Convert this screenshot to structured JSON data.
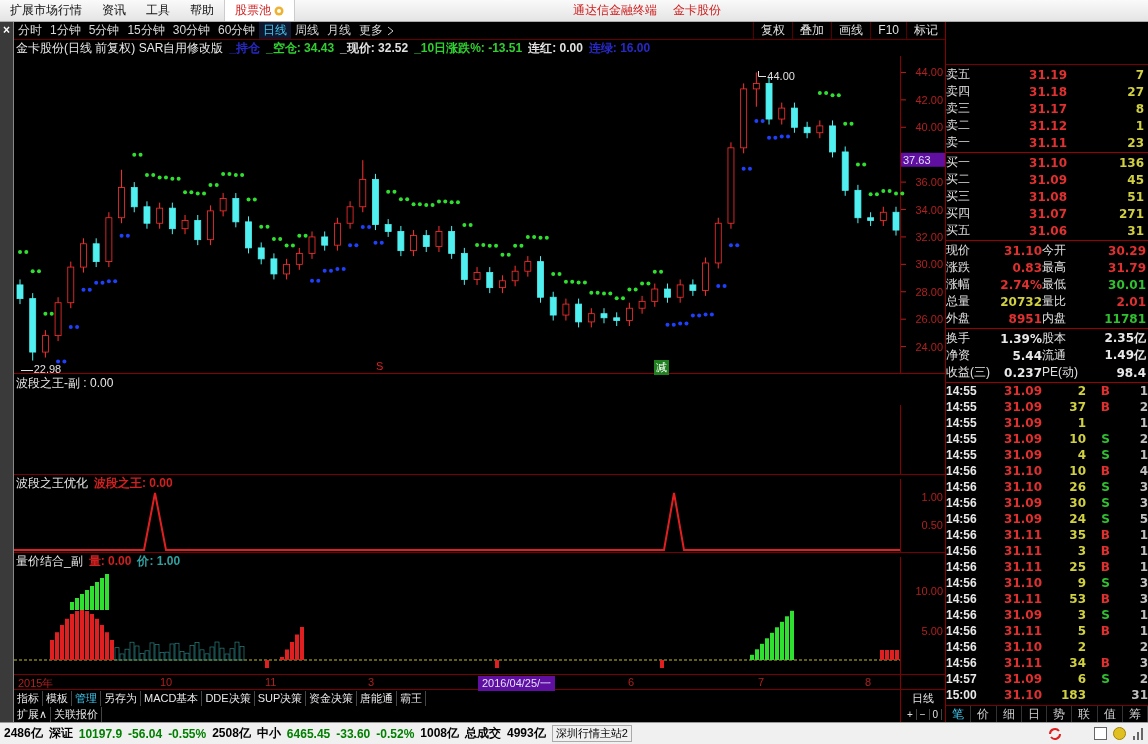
{
  "menu_bar": {
    "items": [
      "扩展市场行情",
      "资讯",
      "工具",
      "帮助"
    ],
    "pool": "股票池",
    "app_title": "通达信金融终端",
    "stock_title": "金卡股份"
  },
  "close_button": "×",
  "period_tabs": [
    {
      "label": "分时",
      "selected": false
    },
    {
      "label": "1分钟",
      "selected": false
    },
    {
      "label": "5分钟",
      "selected": false
    },
    {
      "label": "15分钟",
      "selected": false
    },
    {
      "label": "30分钟",
      "selected": false
    },
    {
      "label": "60分钟",
      "selected": false
    },
    {
      "label": "日线",
      "selected": true
    },
    {
      "label": "周线",
      "selected": false
    },
    {
      "label": "月线",
      "selected": false
    },
    {
      "label": "更多",
      "selected": false
    }
  ],
  "toolbar_buttons": [
    "复权",
    "叠加",
    "画线",
    "F10",
    "标记"
  ],
  "main_chart": {
    "title": "金卡股份(日线 前复权) SAR自用修改版",
    "indicators": [
      {
        "text": "_持仓",
        "color": "#2828c8"
      },
      {
        "text": "_空仓: 34.43",
        "color": "#30d030"
      },
      {
        "text": "_现价: 32.52",
        "color": "#e0e0e0"
      },
      {
        "text": "_10日涨跌%: -13.51",
        "color": "#30d030"
      },
      {
        "text": "连红: 0.00",
        "color": "#e0e0e0"
      },
      {
        "text": "连绿: 16.00",
        "color": "#2828c8"
      }
    ],
    "chart_data": {
      "type": "candlestick",
      "ylim": [
        22,
        45.2
      ],
      "yticks": [
        {
          "value": 44,
          "label": "44.00"
        },
        {
          "value": 42,
          "label": "42.00"
        },
        {
          "value": 40,
          "label": "40.00"
        },
        {
          "value": 36,
          "label": "36.00"
        },
        {
          "value": 34,
          "label": "34.00"
        },
        {
          "value": 32,
          "label": "32.00"
        },
        {
          "value": 30,
          "label": "30.00"
        },
        {
          "value": 28,
          "label": "28.00"
        },
        {
          "value": 26,
          "label": "26.00"
        },
        {
          "value": 24,
          "label": "24.00"
        }
      ],
      "ohlc": [
        [
          28.5,
          28.9,
          27.1,
          27.5
        ],
        [
          27.5,
          27.9,
          22.98,
          23.6
        ],
        [
          23.6,
          25.2,
          23.2,
          24.8
        ],
        [
          24.8,
          27.6,
          24.4,
          27.2
        ],
        [
          27.2,
          30.2,
          26.8,
          29.8
        ],
        [
          29.8,
          31.9,
          29.4,
          31.5
        ],
        [
          31.5,
          31.9,
          29.8,
          30.2
        ],
        [
          30.2,
          33.8,
          29.8,
          33.4
        ],
        [
          33.4,
          36.9,
          33.0,
          35.6
        ],
        [
          35.6,
          36.0,
          33.8,
          34.2
        ],
        [
          34.2,
          34.6,
          32.6,
          33.0
        ],
        [
          33.0,
          34.5,
          32.6,
          34.1
        ],
        [
          34.1,
          34.5,
          32.2,
          32.6
        ],
        [
          32.6,
          33.6,
          32.2,
          33.2
        ],
        [
          33.2,
          33.6,
          31.4,
          31.8
        ],
        [
          31.8,
          34.3,
          31.4,
          33.9
        ],
        [
          33.9,
          35.2,
          33.5,
          34.8
        ],
        [
          34.8,
          35.2,
          32.7,
          33.1
        ],
        [
          33.1,
          33.5,
          30.8,
          31.2
        ],
        [
          31.2,
          31.6,
          30.0,
          30.4
        ],
        [
          30.4,
          30.8,
          28.9,
          29.3
        ],
        [
          29.3,
          30.4,
          28.9,
          30.0
        ],
        [
          30.0,
          31.2,
          29.6,
          30.8
        ],
        [
          30.8,
          32.4,
          30.4,
          32.0
        ],
        [
          32.0,
          32.4,
          31.0,
          31.4
        ],
        [
          31.4,
          33.4,
          31.0,
          33.0
        ],
        [
          33.0,
          34.6,
          32.6,
          34.2
        ],
        [
          34.2,
          37.6,
          33.8,
          36.2
        ],
        [
          36.2,
          36.6,
          32.5,
          32.9
        ],
        [
          32.9,
          33.3,
          32.0,
          32.4
        ],
        [
          32.4,
          32.8,
          30.6,
          31.0
        ],
        [
          31.0,
          32.5,
          30.6,
          32.1
        ],
        [
          32.1,
          32.5,
          30.9,
          31.3
        ],
        [
          31.3,
          32.8,
          30.9,
          32.4
        ],
        [
          32.4,
          32.8,
          30.4,
          30.8
        ],
        [
          30.8,
          31.2,
          28.5,
          28.9
        ],
        [
          28.9,
          29.8,
          28.5,
          29.4
        ],
        [
          29.4,
          29.8,
          27.9,
          28.3
        ],
        [
          28.3,
          29.2,
          27.9,
          28.8
        ],
        [
          28.8,
          29.9,
          28.4,
          29.5
        ],
        [
          29.5,
          30.6,
          29.1,
          30.2
        ],
        [
          30.2,
          30.6,
          27.2,
          27.6
        ],
        [
          27.6,
          28.0,
          25.9,
          26.3
        ],
        [
          26.3,
          27.5,
          25.9,
          27.1
        ],
        [
          27.1,
          27.5,
          25.4,
          25.8
        ],
        [
          25.8,
          26.8,
          25.4,
          26.4
        ],
        [
          26.4,
          26.8,
          25.7,
          26.1
        ],
        [
          26.1,
          26.5,
          25.5,
          25.9
        ],
        [
          25.9,
          27.2,
          25.5,
          26.8
        ],
        [
          26.8,
          27.7,
          26.4,
          27.3
        ],
        [
          27.3,
          28.6,
          26.9,
          28.2
        ],
        [
          28.2,
          28.6,
          27.2,
          27.6
        ],
        [
          27.6,
          28.9,
          27.2,
          28.5
        ],
        [
          28.5,
          28.9,
          27.7,
          28.1
        ],
        [
          28.1,
          30.5,
          27.7,
          30.1
        ],
        [
          30.1,
          33.4,
          29.7,
          33.0
        ],
        [
          33.0,
          38.9,
          32.6,
          38.5
        ],
        [
          38.5,
          43.2,
          38.1,
          42.8
        ],
        [
          42.8,
          44.0,
          41.5,
          43.2
        ],
        [
          43.2,
          43.6,
          40.2,
          40.6
        ],
        [
          40.6,
          41.8,
          40.2,
          41.4
        ],
        [
          41.4,
          41.8,
          39.6,
          40.0
        ],
        [
          40.0,
          40.4,
          39.2,
          39.6
        ],
        [
          39.6,
          40.5,
          39.2,
          40.1
        ],
        [
          40.1,
          40.5,
          37.8,
          38.2
        ],
        [
          38.2,
          38.6,
          35.0,
          35.4
        ],
        [
          35.4,
          35.8,
          33.0,
          33.4
        ],
        [
          33.4,
          33.8,
          32.8,
          33.2
        ],
        [
          33.2,
          34.2,
          32.8,
          33.8
        ],
        [
          33.8,
          34.2,
          32.1,
          32.5
        ]
      ]
    },
    "current_price": "37.63",
    "high_label": "44.00",
    "low_label": "22.98",
    "signals": [
      {
        "text": "S",
        "kind": "sell"
      },
      {
        "text": "减",
        "kind": "reduce"
      }
    ]
  },
  "sub_panels": [
    {
      "title": "波段之王-副 : 0.00"
    },
    {
      "title": "波段之王优化",
      "values": [
        {
          "text": "波段之王: 0.00",
          "color": "#d02020"
        }
      ],
      "y_axis": [
        "1.00",
        "0.50"
      ]
    },
    {
      "title": "量价结合_副",
      "values": [
        {
          "text": "量: 0.00",
          "color": "#d02020"
        },
        {
          "text": "价: 1.00",
          "color": "#30a0a0"
        }
      ],
      "y_axis": [
        "10.00",
        "5.00"
      ]
    }
  ],
  "x_axis": [
    {
      "text": "2015年",
      "kind": "tick"
    },
    {
      "text": "10",
      "kind": "tick"
    },
    {
      "text": "11",
      "kind": "tick"
    },
    {
      "text": "3",
      "kind": "tick"
    },
    {
      "text": "2016/04/25/一",
      "kind": "cursor"
    },
    {
      "text": "6",
      "kind": "tick"
    },
    {
      "text": "7",
      "kind": "tick"
    },
    {
      "text": "8",
      "kind": "tick"
    }
  ],
  "indicator_tabs": [
    {
      "label": "指标",
      "selected": false
    },
    {
      "label": "模板",
      "selected": false
    },
    {
      "label": "管理",
      "selected": true
    },
    {
      "label": "另存为",
      "selected": false
    },
    {
      "label": "MACD基本",
      "selected": false
    },
    {
      "label": "DDE决策",
      "selected": false
    },
    {
      "label": "SUP决策",
      "selected": false
    },
    {
      "label": "资金决策",
      "selected": false
    },
    {
      "label": "唐能通",
      "selected": false
    },
    {
      "label": "霸王",
      "selected": false
    }
  ],
  "period_label": "日线",
  "zoom_buttons": [
    "+",
    "−",
    "0"
  ],
  "expand_links": [
    "扩展∧",
    "关联报价"
  ],
  "asks": [
    {
      "label": "卖五",
      "price": "31.19",
      "volume": "7"
    },
    {
      "label": "卖四",
      "price": "31.18",
      "volume": "27"
    },
    {
      "label": "卖三",
      "price": "31.17",
      "volume": "8"
    },
    {
      "label": "卖二",
      "price": "31.12",
      "volume": "1"
    },
    {
      "label": "卖一",
      "price": "31.11",
      "volume": "23"
    }
  ],
  "bids": [
    {
      "label": "买一",
      "price": "31.10",
      "volume": "136"
    },
    {
      "label": "买二",
      "price": "31.09",
      "volume": "45"
    },
    {
      "label": "买三",
      "price": "31.08",
      "volume": "51"
    },
    {
      "label": "买四",
      "price": "31.07",
      "volume": "271"
    },
    {
      "label": "买五",
      "price": "31.06",
      "volume": "31"
    }
  ],
  "stats": [
    {
      "label": "现价",
      "value": "31.10",
      "color": "#e03030"
    },
    {
      "label": "今开",
      "value": "30.29",
      "color": "#e03030"
    },
    {
      "label": "涨跌",
      "value": "0.83",
      "color": "#e03030"
    },
    {
      "label": "最高",
      "value": "31.79",
      "color": "#e03030"
    },
    {
      "label": "涨幅",
      "value": "2.74%",
      "color": "#e03030"
    },
    {
      "label": "最低",
      "value": "30.01",
      "color": "#30c030"
    },
    {
      "label": "总量",
      "value": "20732",
      "color": "#d0d040"
    },
    {
      "label": "量比",
      "value": "2.01",
      "color": "#e03030"
    },
    {
      "label": "外盘",
      "value": "8951",
      "color": "#e03030"
    },
    {
      "label": "内盘",
      "value": "11781",
      "color": "#30c030"
    }
  ],
  "fundamentals": [
    {
      "label": "换手",
      "value": "1.39%"
    },
    {
      "label": "股本",
      "value": "2.35亿"
    },
    {
      "label": "净资",
      "value": "5.44"
    },
    {
      "label": "流通",
      "value": "1.49亿"
    },
    {
      "label": "收益(三)",
      "value": "0.237"
    },
    {
      "label": "PE(动)",
      "value": "98.4"
    }
  ],
  "trades": [
    {
      "time": "14:55",
      "price": "31.09",
      "volume": "2",
      "side": {
        "text": "B",
        "kind": "buy"
      },
      "count": "1"
    },
    {
      "time": "14:55",
      "price": "31.09",
      "volume": "37",
      "side": {
        "text": "B",
        "kind": "buy"
      },
      "count": "2"
    },
    {
      "time": "14:55",
      "price": "31.09",
      "volume": "1",
      "count": "1"
    },
    {
      "time": "14:55",
      "price": "31.09",
      "volume": "10",
      "side": {
        "text": "S",
        "kind": "sell"
      },
      "count": "2"
    },
    {
      "time": "14:55",
      "price": "31.09",
      "volume": "4",
      "side": {
        "text": "S",
        "kind": "sell"
      },
      "count": "1"
    },
    {
      "time": "14:56",
      "price": "31.10",
      "volume": "10",
      "side": {
        "text": "B",
        "kind": "buy"
      },
      "count": "4"
    },
    {
      "time": "14:56",
      "price": "31.10",
      "volume": "26",
      "side": {
        "text": "S",
        "kind": "sell"
      },
      "count": "3"
    },
    {
      "time": "14:56",
      "price": "31.09",
      "volume": "30",
      "side": {
        "text": "S",
        "kind": "sell"
      },
      "count": "3"
    },
    {
      "time": "14:56",
      "price": "31.09",
      "volume": "24",
      "side": {
        "text": "S",
        "kind": "sell"
      },
      "count": "5"
    },
    {
      "time": "14:56",
      "price": "31.11",
      "volume": "35",
      "side": {
        "text": "B",
        "kind": "buy"
      },
      "count": "1"
    },
    {
      "time": "14:56",
      "price": "31.11",
      "volume": "3",
      "side": {
        "text": "B",
        "kind": "buy"
      },
      "count": "1"
    },
    {
      "time": "14:56",
      "price": "31.11",
      "volume": "25",
      "side": {
        "text": "B",
        "kind": "buy"
      },
      "count": "1"
    },
    {
      "time": "14:56",
      "price": "31.10",
      "volume": "9",
      "side": {
        "text": "S",
        "kind": "sell"
      },
      "count": "3"
    },
    {
      "time": "14:56",
      "price": "31.11",
      "volume": "53",
      "side": {
        "text": "B",
        "kind": "buy"
      },
      "count": "3"
    },
    {
      "time": "14:56",
      "price": "31.09",
      "volume": "3",
      "side": {
        "text": "S",
        "kind": "sell"
      },
      "count": "1"
    },
    {
      "time": "14:56",
      "price": "31.11",
      "volume": "5",
      "side": {
        "text": "B",
        "kind": "buy"
      },
      "count": "1"
    },
    {
      "time": "14:56",
      "price": "31.10",
      "volume": "2",
      "count": "2"
    },
    {
      "time": "14:56",
      "price": "31.11",
      "volume": "34",
      "side": {
        "text": "B",
        "kind": "buy"
      },
      "count": "3"
    },
    {
      "time": "14:57",
      "price": "31.09",
      "volume": "6",
      "side": {
        "text": "S",
        "kind": "sell"
      },
      "count": "2"
    },
    {
      "time": "15:00",
      "price": "31.10",
      "volume": "183",
      "count": "31"
    }
  ],
  "panel_tabs": [
    {
      "label": "笔",
      "selected": true
    },
    {
      "label": "价",
      "selected": false
    },
    {
      "label": "细",
      "selected": false
    },
    {
      "label": "日",
      "selected": false
    },
    {
      "label": "势",
      "selected": false
    },
    {
      "label": "联",
      "selected": false
    },
    {
      "label": "值",
      "selected": false
    },
    {
      "label": "筹",
      "selected": false
    }
  ],
  "status_bar": [
    {
      "text": "2486亿",
      "color": "#000000"
    },
    {
      "text": "深证",
      "color": "#000000"
    },
    {
      "text": "10197.9",
      "color": "#008000"
    },
    {
      "text": "-56.04",
      "color": "#008000"
    },
    {
      "text": "-0.55%",
      "color": "#008000"
    },
    {
      "text": "2508亿",
      "color": "#000000"
    },
    {
      "text": "中小",
      "color": "#000000"
    },
    {
      "text": "6465.45",
      "color": "#008000"
    },
    {
      "text": "-33.60",
      "color": "#008000"
    },
    {
      "text": "-0.52%",
      "color": "#008000"
    },
    {
      "text": "1008亿",
      "color": "#000000"
    },
    {
      "text": "总成交",
      "color": "#000000"
    },
    {
      "text": "4993亿",
      "color": "#000000"
    }
  ],
  "server": "深圳行情主站2"
}
